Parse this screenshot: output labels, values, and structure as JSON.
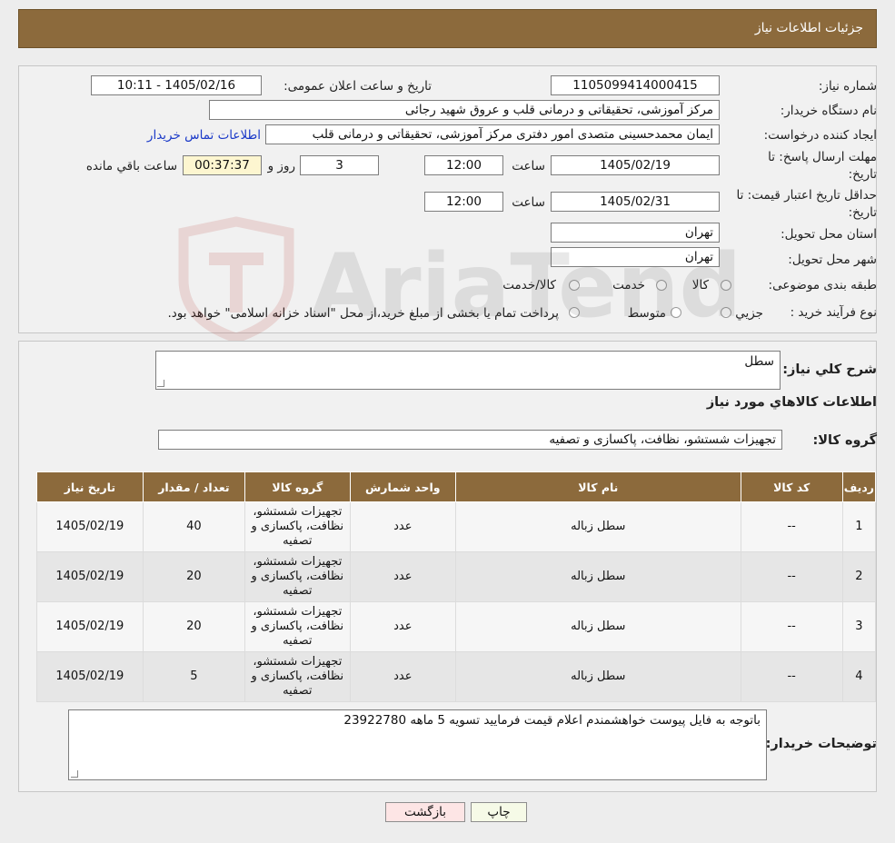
{
  "header": {
    "title": "جزئیات اطلاعات نیاز"
  },
  "form": {
    "need_number_label": "شماره نیاز:",
    "need_number": "1105099414000415",
    "announce_label": "تاریخ و ساعت اعلان عمومی:",
    "announce_value": "1405/02/16 - 10:11",
    "buyer_org_label": "نام دستگاه خریدار:",
    "buyer_org": "مرکز آموزشی، تحقیقاتی و درمانی قلب و عروق شهید رجائی",
    "requester_label": "ایجاد کننده درخواست:",
    "requester": "ایمان محمدحسینی متصدی امور دفتری مرکز آموزشی، تحقیقاتی و درمانی قلب",
    "contact_link": "اطلاعات تماس خریدار",
    "deadline_label_1": "مهلت ارسال پاسخ: تا",
    "deadline_label_2": "تاریخ:",
    "deadline_date": "1405/02/19",
    "time_label": "ساعت",
    "deadline_time": "12:00",
    "days_value": "3",
    "days_label": "روز و",
    "remaining_time": "00:37:37",
    "remaining_label": "ساعت باقي مانده",
    "validity_label_1": "حداقل تاریخ اعتبار قیمت: تا",
    "validity_label_2": "تاریخ:",
    "validity_date": "1405/02/31",
    "validity_time": "12:00",
    "province_label": "استان محل تحویل:",
    "province": "تهران",
    "city_label": "شهر محل تحویل:",
    "city": "تهران",
    "category_label": "طبقه بندی موضوعی:",
    "category_options": [
      "کالا",
      "خدمت",
      "کالا/خدمت"
    ],
    "process_label": "نوع فرآیند خرید :",
    "process_options": [
      "جزیي",
      "متوسط"
    ],
    "payment_note": "پرداخت تمام یا بخشی از مبلغ خرید،از محل \"اسناد خزانه اسلامی\" خواهد بود."
  },
  "needs": {
    "summary_label": "شرح کلي نیاز:",
    "summary": "سطل",
    "goods_info_title": "اطلاعات کالاهاي مورد نیاز",
    "group_label": "گروه کالا:",
    "group_value": "تجهیزات شستشو، نظافت، پاکسازی و تصفیه",
    "table": {
      "headers": [
        "ردیف",
        "کد کالا",
        "نام کالا",
        "واحد شمارش",
        "گروه کالا",
        "تعداد / مقدار",
        "تاریخ نیاز"
      ],
      "rows": [
        [
          "1",
          "--",
          "سطل زباله",
          "عدد",
          "تجهیزات شستشو، نظافت، پاکسازی و تصفیه",
          "40",
          "1405/02/19"
        ],
        [
          "2",
          "--",
          "سطل زباله",
          "عدد",
          "تجهیزات شستشو، نظافت، پاکسازی و تصفیه",
          "20",
          "1405/02/19"
        ],
        [
          "3",
          "--",
          "سطل زباله",
          "عدد",
          "تجهیزات شستشو، نظافت، پاکسازی و تصفیه",
          "20",
          "1405/02/19"
        ],
        [
          "4",
          "--",
          "سطل زباله",
          "عدد",
          "تجهیزات شستشو، نظافت، پاکسازی و تصفیه",
          "5",
          "1405/02/19"
        ]
      ]
    },
    "buyer_notes_label": "توضیحات خریدار:",
    "buyer_notes": "باتوجه به فایل پیوست خواهشمندم اعلام قیمت فرمایید تسویه 5 ماهه 23922780"
  },
  "buttons": {
    "print": "چاپ",
    "back": "بازگشت"
  },
  "watermark": {
    "brand": "AriaTender.neT"
  },
  "colors": {
    "header": "#8c6a3c",
    "back_button": "#fde5e5",
    "print_button": "#f6fae7",
    "timer": "#fdf6d0",
    "link": "#1a39c8"
  }
}
